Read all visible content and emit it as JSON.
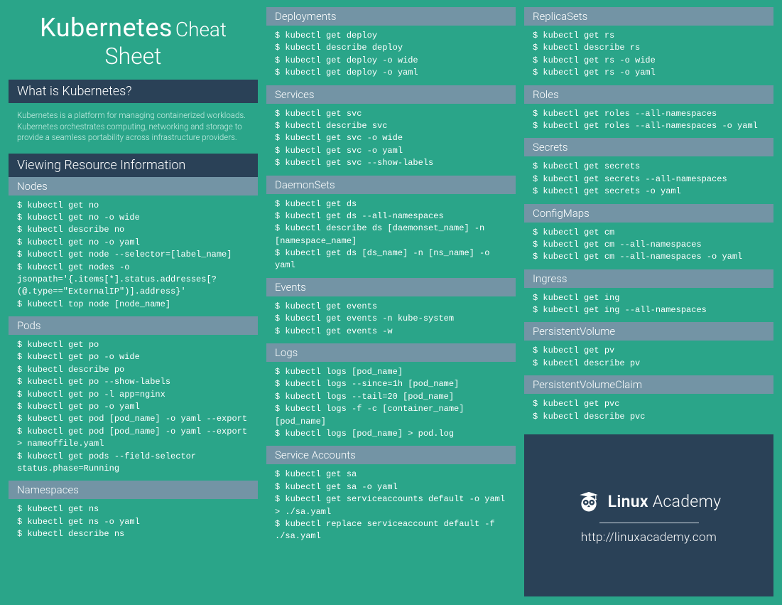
{
  "title": {
    "line1a": "Kubernetes",
    "line1b": "Cheat",
    "line2": "Sheet"
  },
  "whatis": {
    "heading": "What is Kubernetes?",
    "body": "Kubernetes is a platform for managing containerized workloads. Kubernetes orchestrates computing, networking and storage to provide a seamless portability across infrastructure providers."
  },
  "vri_heading": "Viewing Resource Information",
  "col1": {
    "nodes": {
      "h": "Nodes",
      "code": "$ kubectl get no\n$ kubectl get no -o wide\n$ kubectl describe no\n$ kubectl get no -o yaml\n$ kubectl get node --selector=[label_name]\n$ kubectl get nodes -o jsonpath='{.items[*].status.addresses[?(@.type==\"ExternalIP\")].address}'\n$ kubectl top node [node_name]"
    },
    "pods": {
      "h": "Pods",
      "code": "$ kubectl get po\n$ kubectl get po -o wide\n$ kubectl describe po\n$ kubectl get po --show-labels\n$ kubectl get po -l app=nginx\n$ kubectl get po -o yaml\n$ kubectl get pod [pod_name] -o yaml --export\n$ kubectl get pod [pod_name] -o yaml --export > nameoffile.yaml\n$ kubectl get pods --field-selector status.phase=Running"
    },
    "namespaces": {
      "h": "Namespaces",
      "code": "$ kubectl get ns\n$ kubectl get ns -o yaml\n$ kubectl describe ns"
    }
  },
  "col2": {
    "deployments": {
      "h": "Deployments",
      "code": "$ kubectl get deploy\n$ kubectl describe deploy\n$ kubectl get deploy -o wide\n$ kubectl get deploy -o yaml"
    },
    "services": {
      "h": "Services",
      "code": "$ kubectl get svc\n$ kubectl describe svc\n$ kubectl get svc -o wide\n$ kubectl get svc -o yaml\n$ kubectl get svc --show-labels"
    },
    "daemonsets": {
      "h": "DaemonSets",
      "code": "$ kubectl get ds\n$ kubectl get ds --all-namespaces\n$ kubectl describe ds [daemonset_name] -n [namespace_name]\n$ kubectl get ds [ds_name] -n [ns_name] -o yaml"
    },
    "events": {
      "h": "Events",
      "code": "$ kubectl get events\n$ kubectl get events -n kube-system\n$ kubectl get events -w"
    },
    "logs": {
      "h": "Logs",
      "code": "$ kubectl logs [pod_name]\n$ kubectl logs --since=1h [pod_name]\n$ kubectl logs --tail=20 [pod_name]\n$ kubectl logs -f -c [container_name] [pod_name]\n$ kubectl logs [pod_name] > pod.log"
    },
    "serviceaccounts": {
      "h": "Service Accounts",
      "code": "$ kubectl get sa\n$ kubectl get sa -o yaml\n$ kubectl get serviceaccounts default -o yaml > ./sa.yaml\n$ kubectl replace serviceaccount default -f ./sa.yaml"
    }
  },
  "col3": {
    "replicasets": {
      "h": "ReplicaSets",
      "code": "$ kubectl get rs\n$ kubectl describe rs\n$ kubectl get rs -o wide\n$ kubectl get rs -o yaml"
    },
    "roles": {
      "h": "Roles",
      "code": "$ kubectl get roles --all-namespaces\n$ kubectl get roles --all-namespaces -o yaml"
    },
    "secrets": {
      "h": "Secrets",
      "code": "$ kubectl get secrets\n$ kubectl get secrets --all-namespaces\n$ kubectl get secrets -o yaml"
    },
    "configmaps": {
      "h": "ConfigMaps",
      "code": "$ kubectl get cm\n$ kubectl get cm --all-namespaces\n$ kubectl get cm --all-namespaces -o yaml"
    },
    "ingress": {
      "h": "Ingress",
      "code": "$ kubectl get ing\n$ kubectl get ing --all-namespaces"
    },
    "pv": {
      "h": "PersistentVolume",
      "code": "$ kubectl get pv\n$ kubectl describe pv"
    },
    "pvc": {
      "h": "PersistentVolumeClaim",
      "code": "$ kubectl get pvc\n$ kubectl describe pvc"
    }
  },
  "brand": {
    "name_bold": "Linux",
    "name_light": "Academy",
    "url": "http://linuxacademy.com"
  }
}
